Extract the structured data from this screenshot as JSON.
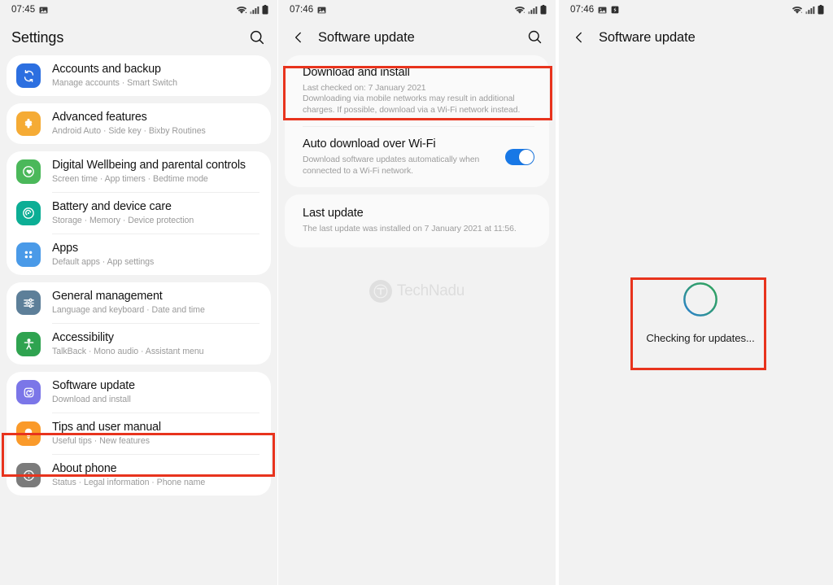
{
  "panels": [
    {
      "id": "settings",
      "status": {
        "time": "07:45",
        "icons": [
          "image-icon"
        ],
        "right_icons": [
          "wifi-icon",
          "signal-icon",
          "battery-icon"
        ]
      },
      "appbar": {
        "title": "Settings",
        "has_back": false,
        "has_search": true
      },
      "groups": [
        {
          "rows": [
            {
              "title": "Accounts and backup",
              "subtitle": "Manage accounts  ·  Smart Switch",
              "icon": "sync-icon",
              "color": "#2c6fe0"
            }
          ]
        },
        {
          "rows": [
            {
              "title": "Advanced features",
              "subtitle": "Android Auto  ·  Side key  ·  Bixby Routines",
              "icon": "puzzle-icon",
              "color": "#f5ab35"
            }
          ]
        },
        {
          "rows": [
            {
              "title": "Digital Wellbeing and parental controls",
              "subtitle": "Screen time  ·  App timers  ·  Bedtime mode",
              "icon": "wellbeing-icon",
              "color": "#4bb85a"
            },
            {
              "title": "Battery and device care",
              "subtitle": "Storage  ·  Memory  ·  Device protection",
              "icon": "battery-care-icon",
              "color": "#0cae95"
            },
            {
              "title": "Apps",
              "subtitle": "Default apps  ·  App settings",
              "icon": "apps-grid-icon",
              "color": "#4a9ae8"
            }
          ]
        },
        {
          "rows": [
            {
              "title": "General management",
              "subtitle": "Language and keyboard  ·  Date and time",
              "icon": "sliders-icon",
              "color": "#5d7f99"
            },
            {
              "title": "Accessibility",
              "subtitle": "TalkBack  ·  Mono audio  ·  Assistant menu",
              "icon": "accessibility-icon",
              "color": "#2fa350"
            }
          ]
        },
        {
          "rows": [
            {
              "title": "Software update",
              "subtitle": "Download and install",
              "icon": "software-update-icon",
              "color": "#7b76e8",
              "highlighted": true
            },
            {
              "title": "Tips and user manual",
              "subtitle": "Useful tips  ·  New features",
              "icon": "lightbulb-icon",
              "color": "#fa9a2a"
            },
            {
              "title": "About phone",
              "subtitle": "Status  ·  Legal information  ·  Phone name",
              "icon": "info-icon",
              "color": "#7b7b7b"
            }
          ]
        }
      ]
    },
    {
      "id": "software-update",
      "status": {
        "time": "07:46",
        "icons": [
          "image-icon"
        ],
        "right_icons": [
          "wifi-icon",
          "signal-icon",
          "battery-icon"
        ]
      },
      "appbar": {
        "title": "Software update",
        "has_back": true,
        "has_search": true
      },
      "blocks": [
        {
          "name": "download-and-install",
          "title": "Download and install",
          "lines": [
            "Last checked on: 7 January 2021",
            "Downloading via mobile networks may result in additional",
            "charges. If possible, download via a Wi-Fi network instead."
          ],
          "highlighted": true
        },
        {
          "name": "auto-download-over-wifi",
          "title": "Auto download over Wi-Fi",
          "lines": [
            "Download software updates automatically when",
            "connected to a Wi-Fi network."
          ],
          "toggle": true,
          "toggle_on": true
        },
        {
          "name": "last-update",
          "title": "Last update",
          "lines": [
            "The last update was installed on 7 January 2021 at 11:56."
          ]
        }
      ],
      "watermark": "TechNadu"
    },
    {
      "id": "checking",
      "status": {
        "time": "07:46",
        "icons": [
          "image-icon",
          "download-icon"
        ],
        "right_icons": [
          "wifi-icon",
          "signal-icon",
          "battery-icon"
        ]
      },
      "appbar": {
        "title": "Software update",
        "has_back": true,
        "has_search": false
      },
      "checking": {
        "label": "Checking for updates...",
        "spinner_colors": [
          "#2fa35e",
          "#2b7fd4"
        ],
        "highlighted": true
      }
    }
  ],
  "annotation_color": "#e8331d"
}
